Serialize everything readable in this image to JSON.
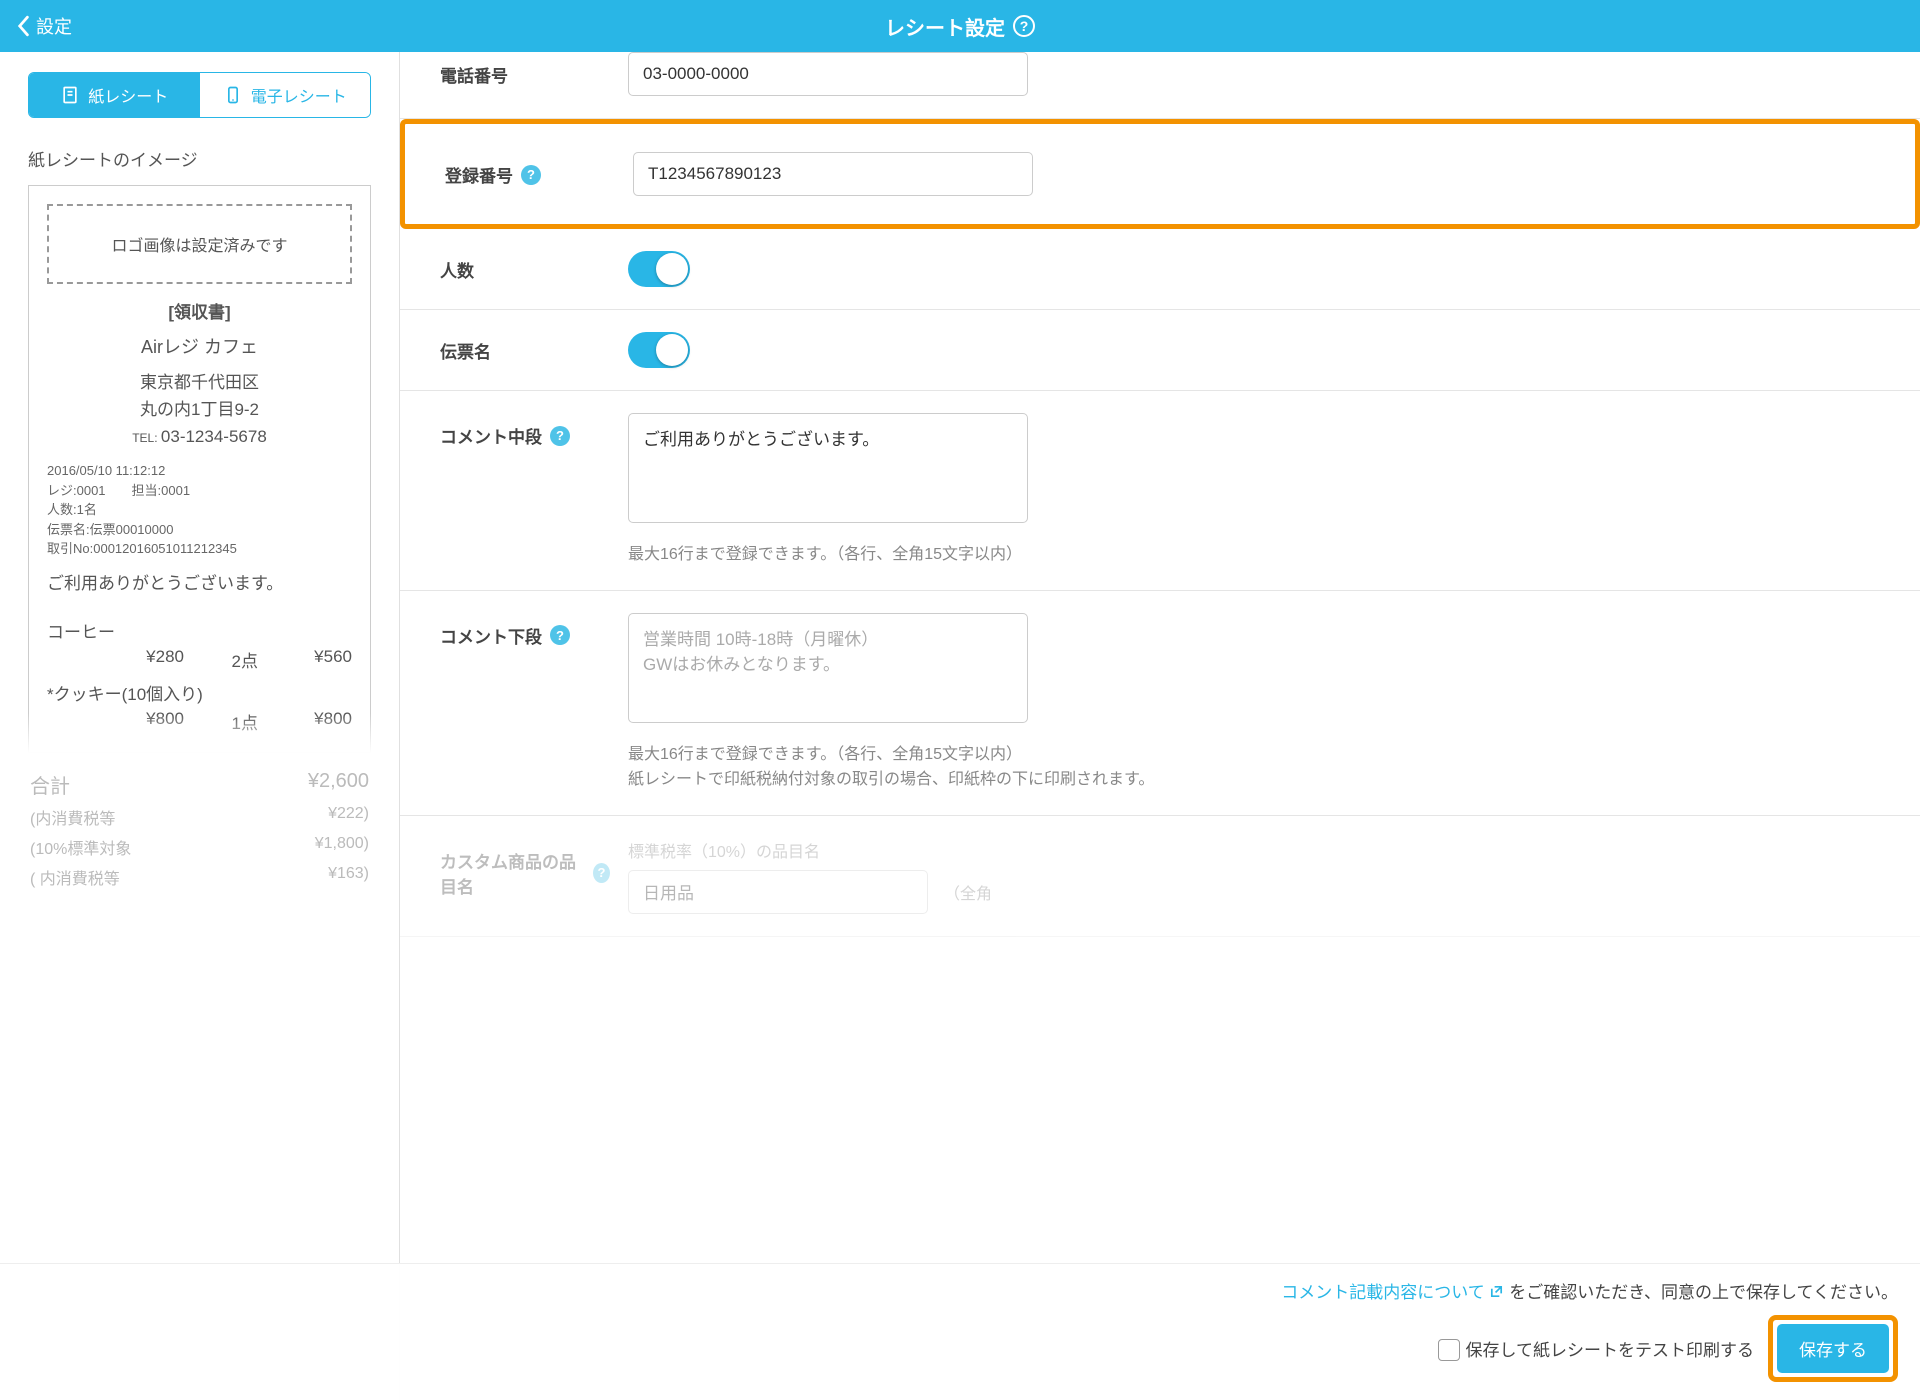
{
  "header": {
    "back": "設定",
    "title": "レシート設定"
  },
  "tabs": {
    "paper": "紙レシート",
    "digital": "電子レシート"
  },
  "preview": {
    "title": "紙レシートのイメージ",
    "logo": "ロゴ画像は設定済みです",
    "heading": "[領収書]",
    "shop": "Airレジ カフェ",
    "addr1": "東京都千代田区",
    "addr2": "丸の内1丁目9-2",
    "tel": "03-1234-5678",
    "meta1": "2016/05/10 11:12:12",
    "meta2": "レジ:0001　　担当:0001",
    "meta3": "人数:1名",
    "meta4": "伝票名:伝票00010000",
    "meta5": "取引No:00012016051011212345",
    "msg": "ご利用ありがとうございます。",
    "item1": "コーヒー",
    "i1p": "¥280",
    "i1q": "2点",
    "i1t": "¥560",
    "item2": "*クッキー(10個入り)",
    "i2p": "¥800",
    "i2q": "1点",
    "i2t": "¥800",
    "tot_label": "合計",
    "tot": "¥2,600",
    "tax_label": "(内消費税等",
    "tax": "¥222)",
    "std_label": "(10%標準対象",
    "std": "¥1,800)",
    "sti_label": "( 内消費税等",
    "sti": "¥163)"
  },
  "form": {
    "phone_label": "電話番号",
    "phone": "03-0000-0000",
    "regnum_label": "登録番号",
    "regnum": "T1234567890123",
    "people_label": "人数",
    "slip_label": "伝票名",
    "cmid_label": "コメント中段",
    "cmid": "ご利用ありがとうございます。",
    "cmid_hint": "最大16行まで登録できます。（各行、全角15文字以内）",
    "cbot_label": "コメント下段",
    "cbot_ph": "営業時間 10時-18時（月曜休）\nGWはお休みとなります。",
    "cbot_hint": "最大16行まで登録できます。（各行、全角15文字以内）\n紙レシートで印紙税納付対象の取引の場合、印紙枠の下に印刷されます。",
    "custom_label": "カスタム商品の品目名",
    "custom_sub": "標準税率（10%）の品目名",
    "custom_val": "日用品",
    "custom_sub2": "（全角"
  },
  "footer": {
    "link": "コメント記載内容について",
    "after": "をご確認いただき、同意の上で保存してください。",
    "check": "保存して紙レシートをテスト印刷する",
    "save": "保存する"
  }
}
